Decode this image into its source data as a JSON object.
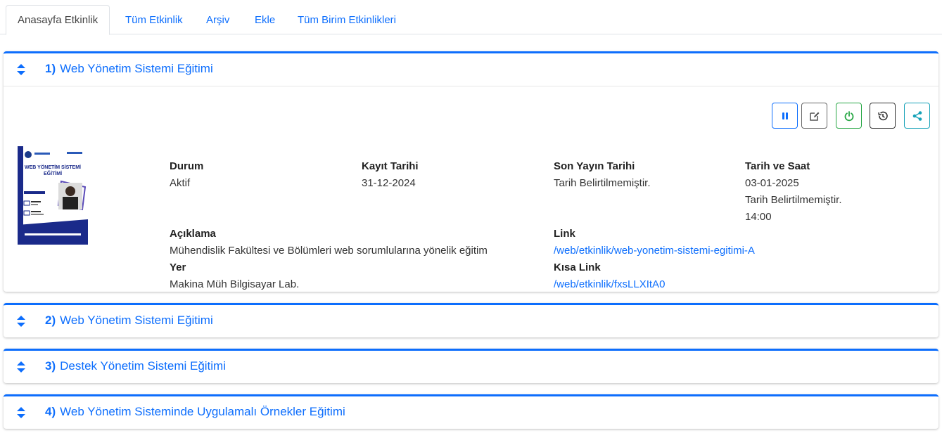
{
  "tabs": [
    {
      "label": "Anasayfa Etkinlik",
      "active": true
    },
    {
      "label": "Tüm Etkinlik"
    },
    {
      "label": "Arşiv"
    },
    {
      "label": "Ekle"
    },
    {
      "label": "Tüm Birim Etkinlikleri"
    }
  ],
  "colors": {
    "accent": "#0d6efd",
    "success": "#28a745",
    "info": "#17a2b8",
    "dark": "#333333"
  },
  "events": [
    {
      "number": "1)",
      "title": "Web Yönetim Sistemi Eğitimi",
      "expanded": true,
      "details": {
        "durum_label": "Durum",
        "durum": "Aktif",
        "kayit_label": "Kayıt Tarihi",
        "kayit": "31-12-2024",
        "son_yayin_label": "Son Yayın Tarihi",
        "son_yayin": "Tarih Belirtilmemiştir.",
        "tarih_saat_label": "Tarih ve Saat",
        "tarih": "03-01-2025",
        "tarih_note": "Tarih Belirtilmemiştir.",
        "saat": "14:00",
        "aciklama_label": "Açıklama",
        "aciklama": "Mühendislik Fakültesi ve Bölümleri web sorumlularına yönelik eğitim",
        "link_label": "Link",
        "link": "/web/etkinlik/web-yonetim-sistemi-egitimi-A",
        "yer_label": "Yer",
        "yer": "Makina Müh Bilgisayar Lab.",
        "kisa_link_label": "Kısa Link",
        "kisa_link": "/web/etkinlik/fxsLLXItA0"
      },
      "poster": {
        "title_line1": "WEB YÖNETİM SİSTEMİ",
        "title_line2": "EĞİTİMİ"
      },
      "actions": [
        {
          "name": "pause-button",
          "icon": "pause-icon",
          "color": "#0d6efd"
        },
        {
          "name": "edit-button",
          "icon": "edit-icon",
          "color": "#555555"
        },
        {
          "name": "power-button",
          "icon": "power-icon",
          "color": "#28a745"
        },
        {
          "name": "history-button",
          "icon": "history-icon",
          "color": "#333333"
        },
        {
          "name": "share-button",
          "icon": "share-icon",
          "color": "#17a2b8"
        }
      ]
    },
    {
      "number": "2)",
      "title": "Web Yönetim Sistemi Eğitimi",
      "expanded": false
    },
    {
      "number": "3)",
      "title": "Destek Yönetim Sistemi Eğitimi",
      "expanded": false
    },
    {
      "number": "4)",
      "title": "Web Yönetim Sisteminde Uygulamalı Örnekler Eğitimi",
      "expanded": false
    }
  ]
}
